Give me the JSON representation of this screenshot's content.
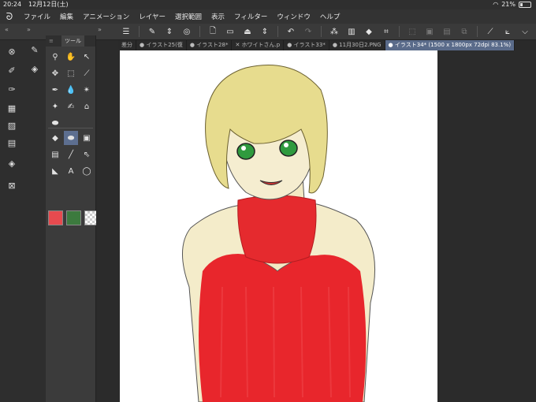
{
  "status_bar": {
    "time": "20:24",
    "date": "12月12日(土)",
    "battery": "21%"
  },
  "menu": {
    "items": [
      "ファイル",
      "編集",
      "アニメーション",
      "レイヤー",
      "選択範囲",
      "表示",
      "フィルター",
      "ウィンドウ",
      "ヘルプ"
    ]
  },
  "tool_panel": {
    "title": "ツール"
  },
  "tabs": [
    {
      "label": "差分",
      "active": false
    },
    {
      "label": "● イラスト25(復",
      "active": false
    },
    {
      "label": "● イラスト28*",
      "active": false
    },
    {
      "label": "✕ ホワイトさん.p",
      "active": false
    },
    {
      "label": "● イラスト33*",
      "active": false
    },
    {
      "label": "● 11月30日2.PNG",
      "active": false
    },
    {
      "label": "● イラスト34* (1500 x 1800px 72dpi 83.1%)",
      "active": true
    }
  ],
  "colors": {
    "main": "#e74a4f",
    "sub": "#3c7a3e",
    "accent": "#5a6b8a"
  },
  "toolbar_icons": [
    "menu-icon",
    "brush-settings-icon",
    "undo-icon",
    "redo-icon",
    "transform-icon"
  ],
  "artwork": {
    "subject": "anime girl with short blonde hair, green eyes, red sleeveless turtleneck sweater",
    "hair": "#e7dc8e",
    "eyes": "#2f9a3e",
    "sweater": "#e8262c",
    "skin": "#f3e9c3"
  }
}
